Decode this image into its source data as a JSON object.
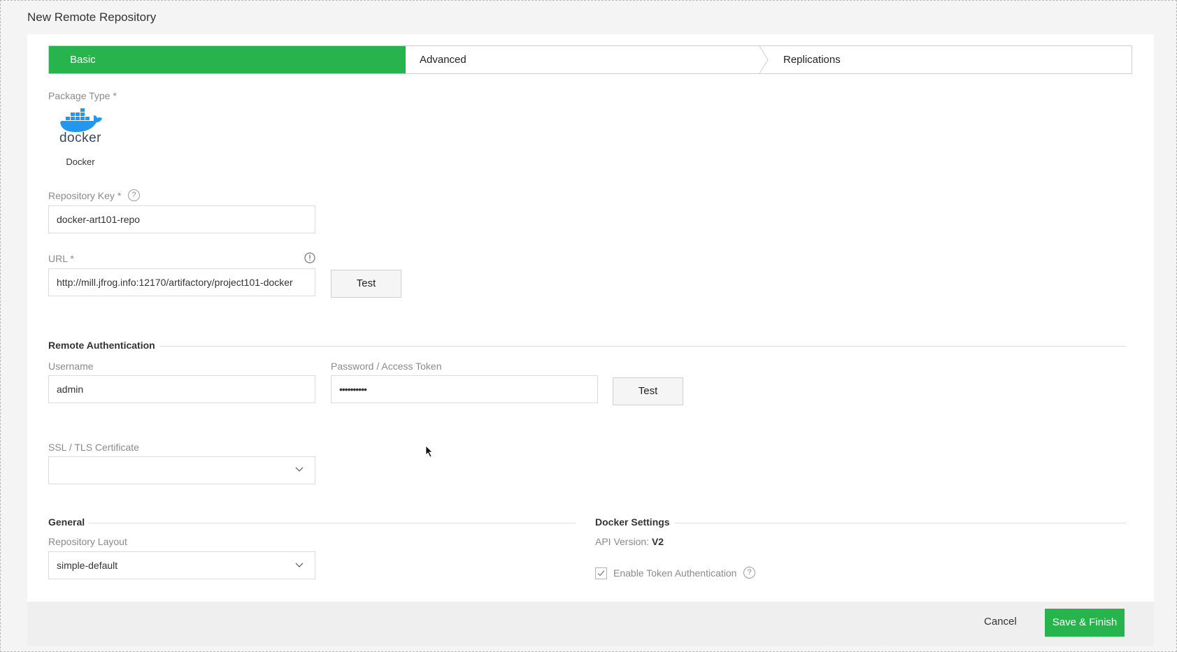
{
  "dialog": {
    "title": "New Remote Repository"
  },
  "wizard": {
    "steps": [
      {
        "label": "Basic",
        "active": true
      },
      {
        "label": "Advanced",
        "active": false
      },
      {
        "label": "Replications",
        "active": false
      }
    ],
    "active_color": "#27b44d"
  },
  "package_type": {
    "label": "Package Type *",
    "logo_text": "docker",
    "name": "Docker"
  },
  "repo_key": {
    "label": "Repository Key *",
    "value": "docker-art101-repo"
  },
  "url": {
    "label": "URL *",
    "value": "http://mill.jfrog.info:12170/artifactory/project101-docker",
    "test_label": "Test"
  },
  "remote_auth": {
    "title": "Remote Authentication",
    "username_label": "Username",
    "username_value": "admin",
    "password_label": "Password / Access Token",
    "password_value": "••••••••••",
    "test_label": "Test"
  },
  "ssl": {
    "label": "SSL / TLS Certificate",
    "value": ""
  },
  "general": {
    "title": "General",
    "layout_label": "Repository Layout",
    "layout_value": "simple-default"
  },
  "docker_settings": {
    "title": "Docker Settings",
    "api_label": "API Version:",
    "api_value": "V2",
    "token_auth_label": "Enable Token Authentication",
    "token_auth_checked": true
  },
  "footer": {
    "cancel_label": "Cancel",
    "save_label": "Save & Finish"
  }
}
